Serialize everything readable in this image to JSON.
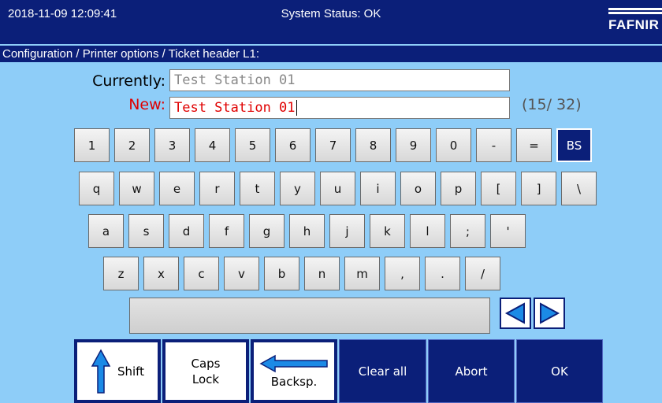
{
  "header": {
    "datetime": "2018-11-09  12:09:41",
    "status": "System Status: OK",
    "logo_text": "FAFNIR"
  },
  "breadcrumb": "Configuration / Printer options / Ticket header L1:",
  "fields": {
    "current_label": "Currently:",
    "current_value": "Test Station 01",
    "new_label": "New:",
    "new_value": "Test Station 01",
    "counter": "(15/ 32)"
  },
  "keyboard": {
    "row1": [
      "1",
      "2",
      "3",
      "4",
      "5",
      "6",
      "7",
      "8",
      "9",
      "0",
      "-",
      "=",
      "BS"
    ],
    "row2": [
      "q",
      "w",
      "e",
      "r",
      "t",
      "y",
      "u",
      "i",
      "o",
      "p",
      "[",
      "]",
      "\\"
    ],
    "row3": [
      "a",
      "s",
      "d",
      "f",
      "g",
      "h",
      "j",
      "k",
      "l",
      ";",
      "'"
    ],
    "row4": [
      "z",
      "x",
      "c",
      "v",
      "b",
      "n",
      "m",
      ",",
      ".",
      "/"
    ]
  },
  "function_buttons": {
    "shift": "Shift",
    "caps_line1": "Caps",
    "caps_line2": "Lock",
    "backspace": "Backsp.",
    "clear_all": "Clear all",
    "abort": "Abort",
    "ok": "OK"
  },
  "colors": {
    "background": "#8ecdf8",
    "header_bg": "#0b1f79",
    "new_text": "#e00000",
    "current_text": "#888888"
  },
  "icons": {
    "left": "left-arrow-icon",
    "right": "right-arrow-icon",
    "shift": "up-arrow-icon",
    "backspace": "left-arrow-icon"
  }
}
